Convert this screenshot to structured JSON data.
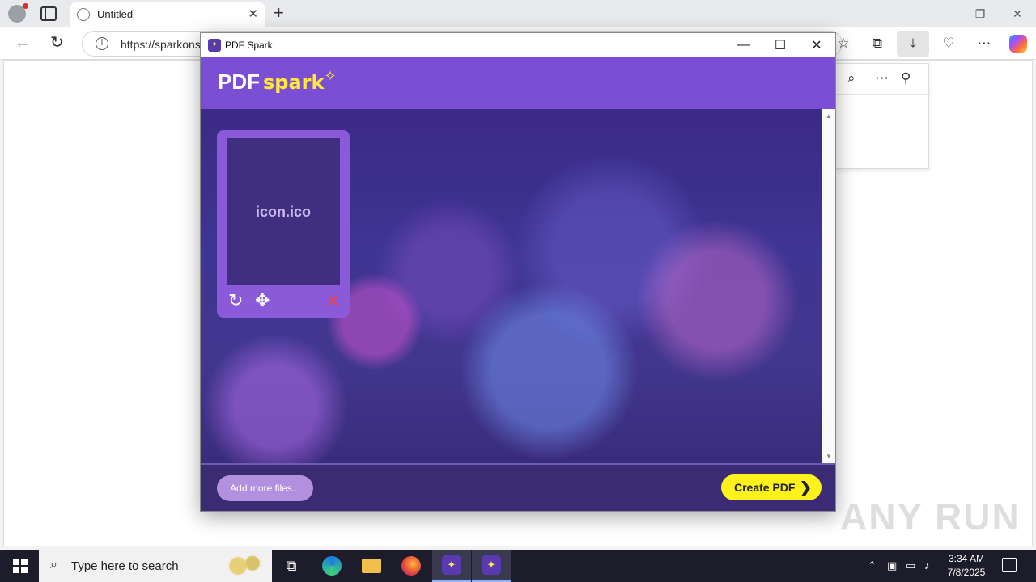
{
  "browser": {
    "tab_title": "Untitled",
    "tab_close": "✕",
    "new_tab": "+",
    "url": "https://sparkons",
    "minimize": "—",
    "restore": "❐",
    "close": "✕"
  },
  "app": {
    "window_title": "PDF Spark",
    "logo_pdf": "PDF",
    "logo_spark": "spark",
    "file_name": "icon.ico",
    "add_more_label": "Add more files...",
    "create_label": "Create PDF"
  },
  "taskbar": {
    "search_placeholder": "Type here to search",
    "time": "3:34 AM",
    "date": "7/8/2025"
  },
  "watermark": "ANY RUN"
}
